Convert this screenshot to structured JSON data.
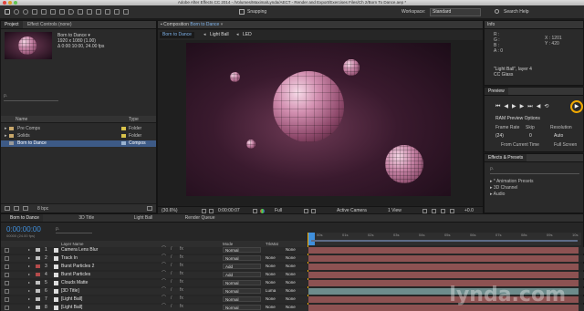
{
  "window": {
    "title": "Adobe After Effects CC 2014 - /Volumes/Maxima/Lynda/AECT - Render and Export/Exercises Files/Ch 2/Born To Dance.aep *"
  },
  "toolbar": {
    "snapping": "Snapping",
    "workspace_label": "Workspace:",
    "workspace_value": "Standard",
    "search_placeholder": "Search Help"
  },
  "project": {
    "tab": "Project",
    "tab2": "Effect Controls (none)",
    "item_name": "Born to Dance ▾",
    "item_size": "1920 x 1080 (1.00)",
    "item_duration": "Δ 0:00:10:00, 24.00 fps",
    "col_name": "Name",
    "col_type": "Type",
    "rows": [
      {
        "name": "Pre Comps",
        "type": "Folder"
      },
      {
        "name": "Solids",
        "type": "Folder"
      },
      {
        "name": "Born to Dance",
        "type": "Compos"
      }
    ],
    "footer": "8 bpc"
  },
  "composition": {
    "tab": "Composition",
    "tab_name": "Born to Dance",
    "breadcrumbs": [
      "Born to Dance",
      "Light Ball",
      "LED"
    ],
    "zoom": "(30.6%)",
    "timecode": "0:00:00:07",
    "resolution": "Full",
    "camera": "Active Camera",
    "view": "1 View",
    "exposure": "+0.0"
  },
  "info": {
    "tab": "Info",
    "r": "R :",
    "g": "G :",
    "b": "B :",
    "a": "A : 0",
    "x": "X : 1201",
    "y": "Y : 420",
    "layer_name": "\"Light Ball\", layer 4",
    "effect": "CC Glass"
  },
  "preview": {
    "tab": "Preview",
    "options_label": "RAM Preview Options",
    "frame_rate_label": "Frame Rate",
    "skip_label": "Skip",
    "resolution_label": "Resolution",
    "frame_rate_value": "(24)",
    "skip_value": "0",
    "resolution_value": "Auto",
    "from_current_time": "From Current Time",
    "full_screen": "Full Screen"
  },
  "effects": {
    "tab": "Effects & Presets",
    "search_placeholder": "ρ.",
    "items": [
      "* Animation Presets",
      "3D Channel",
      "Audio"
    ]
  },
  "timeline": {
    "tabs": [
      "Born to Dance",
      "3D Title",
      "Light Ball",
      "Render Queue"
    ],
    "timecode": "0:00:00:00",
    "frames": "00000 (24.00 fps)",
    "col_layer": "Layer Name",
    "col_mode": "Mode",
    "col_trkmat": "TrkMat",
    "col_parent": "Parent",
    "ruler": [
      "00s",
      "01s",
      "02s",
      "03s",
      "04s",
      "05s",
      "06s",
      "07s",
      "08s",
      "09s",
      "10s"
    ],
    "layers": [
      {
        "num": "1",
        "name": "Camera Lens Blur",
        "mode": "Normal",
        "trkmat": "",
        "parent": "None",
        "color": "#c0c0c0",
        "bar": "#8d5252"
      },
      {
        "num": "2",
        "name": "Track In",
        "mode": "Normal",
        "trkmat": "None",
        "parent": "None",
        "color": "#c0c0c0",
        "bar": "#8d5252"
      },
      {
        "num": "3",
        "name": "Burst Particles 2",
        "mode": "Add",
        "trkmat": "None",
        "parent": "None",
        "color": "#b44b4b",
        "bar": "#8d5252"
      },
      {
        "num": "4",
        "name": "Burst Particles",
        "mode": "Add",
        "trkmat": "None",
        "parent": "None",
        "color": "#b44b4b",
        "bar": "#8d5252"
      },
      {
        "num": "5",
        "name": "Clouds Matte",
        "mode": "Normal",
        "trkmat": "None",
        "parent": "None",
        "color": "#c0c0c0",
        "bar": "#8d5252"
      },
      {
        "num": "6",
        "name": "[3D Title]",
        "mode": "Normal",
        "trkmat": "Luma",
        "parent": "None",
        "color": "#c0c0c0",
        "bar": "#6d8c8c"
      },
      {
        "num": "7",
        "name": "[Light Ball]",
        "mode": "Normal",
        "trkmat": "None",
        "parent": "None",
        "color": "#c0c0c0",
        "bar": "#8d5252"
      },
      {
        "num": "8",
        "name": "[Light Ball]",
        "mode": "Normal",
        "trkmat": "None",
        "parent": "None",
        "color": "#c0c0c0",
        "bar": "#8d5252"
      }
    ]
  },
  "watermark": {
    "text": "lynda.com"
  }
}
